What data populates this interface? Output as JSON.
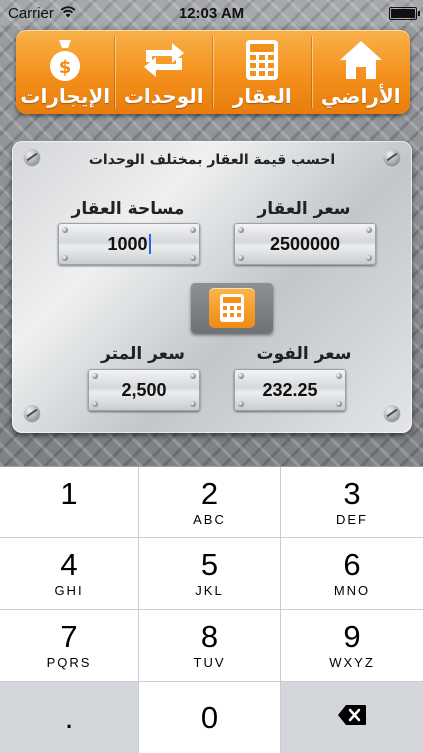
{
  "status_bar": {
    "carrier": "Carrier",
    "time": "12:03 AM"
  },
  "tabs": [
    {
      "label": "الإيجارات",
      "icon": "money-bag-icon"
    },
    {
      "label": "الوحدات",
      "icon": "swap-arrows-icon"
    },
    {
      "label": "العقار",
      "icon": "calculator-icon"
    },
    {
      "label": "الأراضي",
      "icon": "home-icon"
    }
  ],
  "panel": {
    "title": "احسب قيمة العقار بمختلف الوحدات",
    "property_price_label": "سعر العقار",
    "property_price_value": "2500000",
    "property_area_label": "مساحة العقار",
    "property_area_value": "1000",
    "foot_price_label": "سعر الفوت",
    "foot_price_value": "232.25",
    "meter_price_label": "سعر المتر",
    "meter_price_value": "2,500"
  },
  "keypad": {
    "keys": [
      {
        "num": "1",
        "sub": ""
      },
      {
        "num": "2",
        "sub": "ABC"
      },
      {
        "num": "3",
        "sub": "DEF"
      },
      {
        "num": "4",
        "sub": "GHI"
      },
      {
        "num": "5",
        "sub": "JKL"
      },
      {
        "num": "6",
        "sub": "MNO"
      },
      {
        "num": "7",
        "sub": "PQRS"
      },
      {
        "num": "8",
        "sub": "TUV"
      },
      {
        "num": "9",
        "sub": "WXYZ"
      },
      {
        "num": ".",
        "sub": ""
      },
      {
        "num": "0",
        "sub": ""
      }
    ]
  }
}
